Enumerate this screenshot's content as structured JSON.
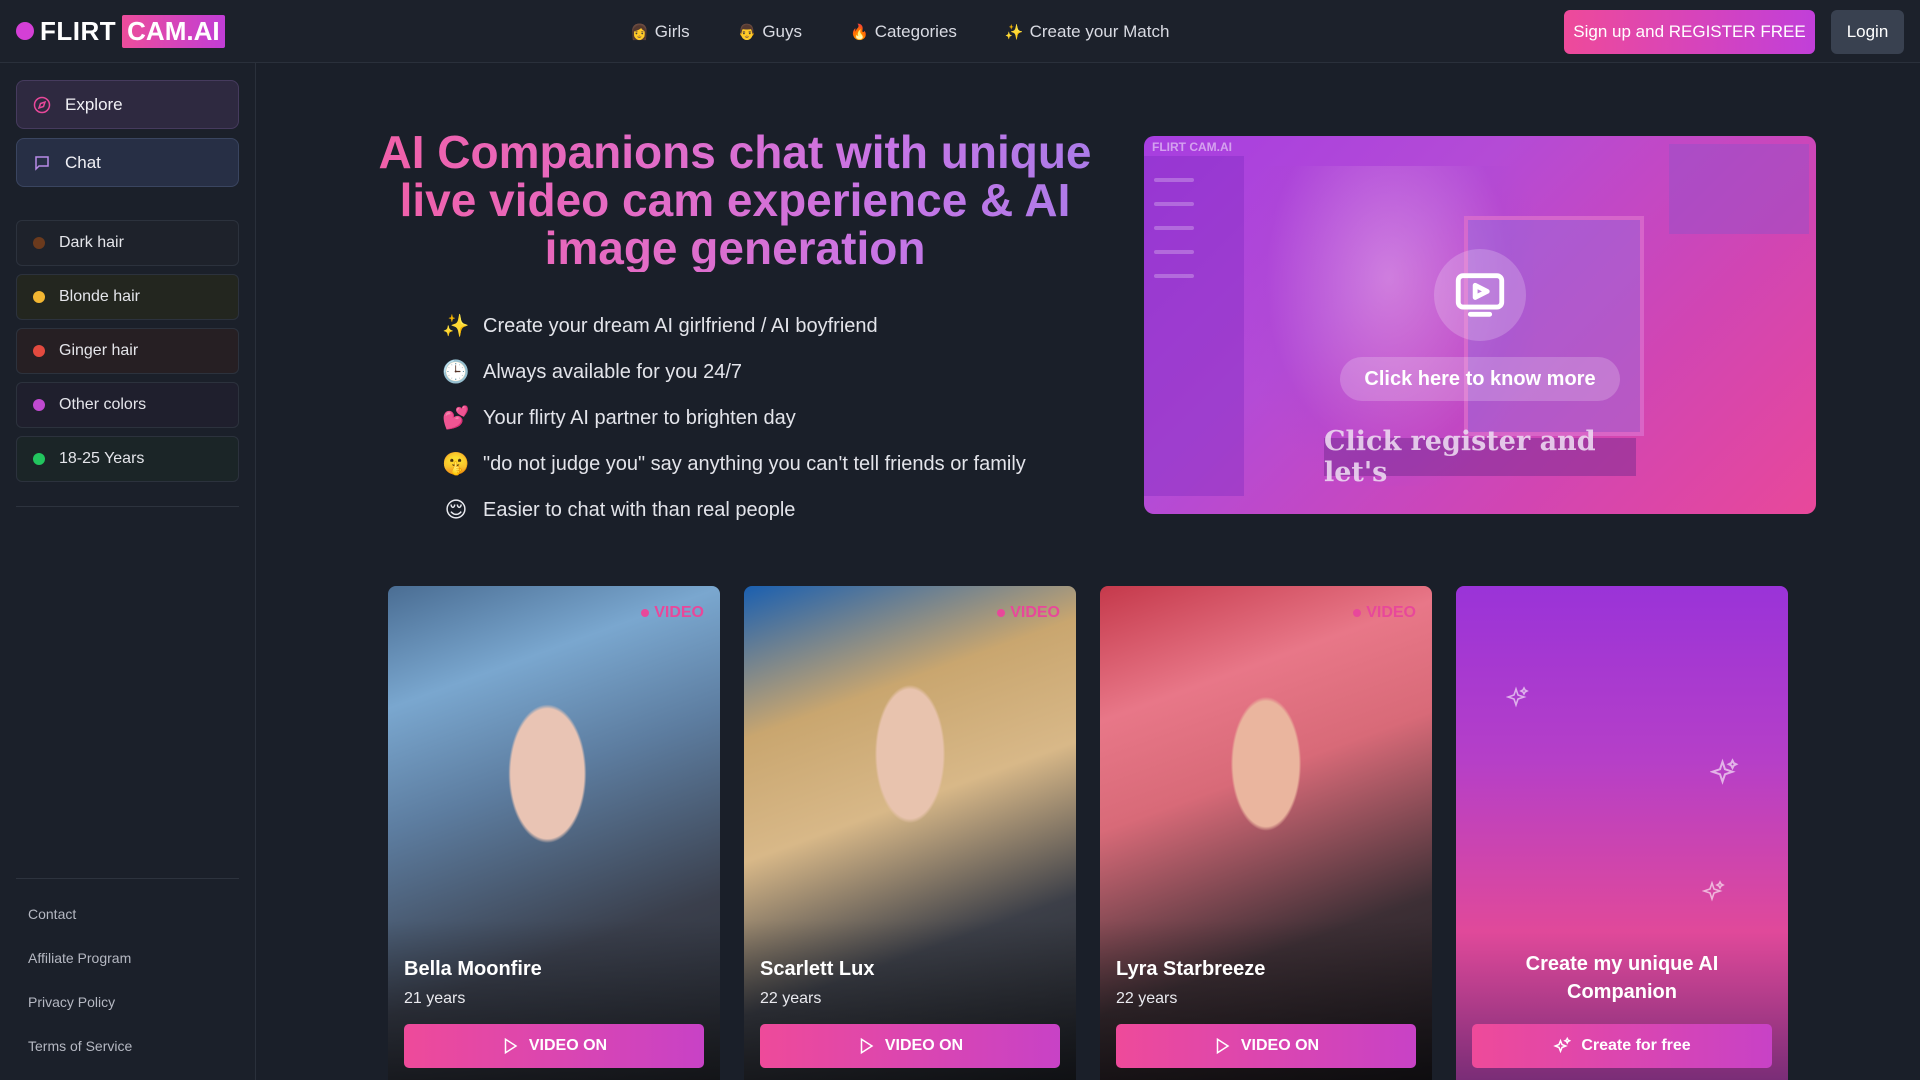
{
  "header": {
    "logo": {
      "flirt": "FLIRT",
      "cam": "CAM.AI"
    },
    "nav": [
      {
        "icon": "👩",
        "label": "Girls"
      },
      {
        "icon": "👨",
        "label": "Guys"
      },
      {
        "icon": "🔥",
        "label": "Categories"
      },
      {
        "icon": "✨",
        "label": "Create your Match"
      }
    ],
    "signup_label": "Sign up and REGISTER FREE",
    "login_label": "Login"
  },
  "sidebar": {
    "main": [
      {
        "icon": "compass-icon",
        "label": "Explore"
      },
      {
        "icon": "chat-bubble-icon",
        "label": "Chat"
      }
    ],
    "filters": [
      {
        "label": "Dark hair",
        "color": "#6b3a1d",
        "bg": "#1e222b"
      },
      {
        "label": "Blonde hair",
        "color": "#f2b632",
        "bg": "#23261f"
      },
      {
        "label": "Ginger hair",
        "color": "#e24a3f",
        "bg": "#261f23"
      },
      {
        "label": "Other colors",
        "color": "#c04ad0",
        "bg": "#1f1f2d"
      },
      {
        "label": "18-25 Years",
        "color": "#22c55e",
        "bg": "#1b2527"
      }
    ],
    "footer": [
      "Contact",
      "Affiliate Program",
      "Privacy Policy",
      "Terms of Service"
    ]
  },
  "hero": {
    "title": "AI Companions chat with unique live video cam experience & AI image generation",
    "features": [
      {
        "emoji": "✨",
        "text": "Create your dream AI girlfriend / AI boyfriend"
      },
      {
        "emoji": "🕒",
        "text": "Always available for you 24/7"
      },
      {
        "emoji": "💕",
        "text": "Your flirty AI partner to brighten day"
      },
      {
        "emoji": "🤫",
        "text": "\"do not judge you\" say anything you can't tell friends or family"
      },
      {
        "emoji": "😌",
        "text": "Easier to chat with than real people"
      }
    ],
    "promo": {
      "know_more": "Click here to know more",
      "caption": "Click register and let's",
      "logo_text": "FLIRT CAM.AI"
    }
  },
  "cards": [
    {
      "name": "Bella Moonfire",
      "age": "21 years",
      "badge": "VIDEO",
      "button": "VIDEO ON"
    },
    {
      "name": "Scarlett Lux",
      "age": "22 years",
      "badge": "VIDEO",
      "button": "VIDEO ON"
    },
    {
      "name": "Lyra Starbreeze",
      "age": "22 years",
      "badge": "VIDEO",
      "button": "VIDEO ON"
    }
  ],
  "create_card": {
    "title": "Create my unique AI Companion",
    "button": "Create for free"
  },
  "colors": {
    "accent_pink": "#ee4a9a",
    "accent_purple": "#c13fd9",
    "background": "#1a1f29"
  }
}
